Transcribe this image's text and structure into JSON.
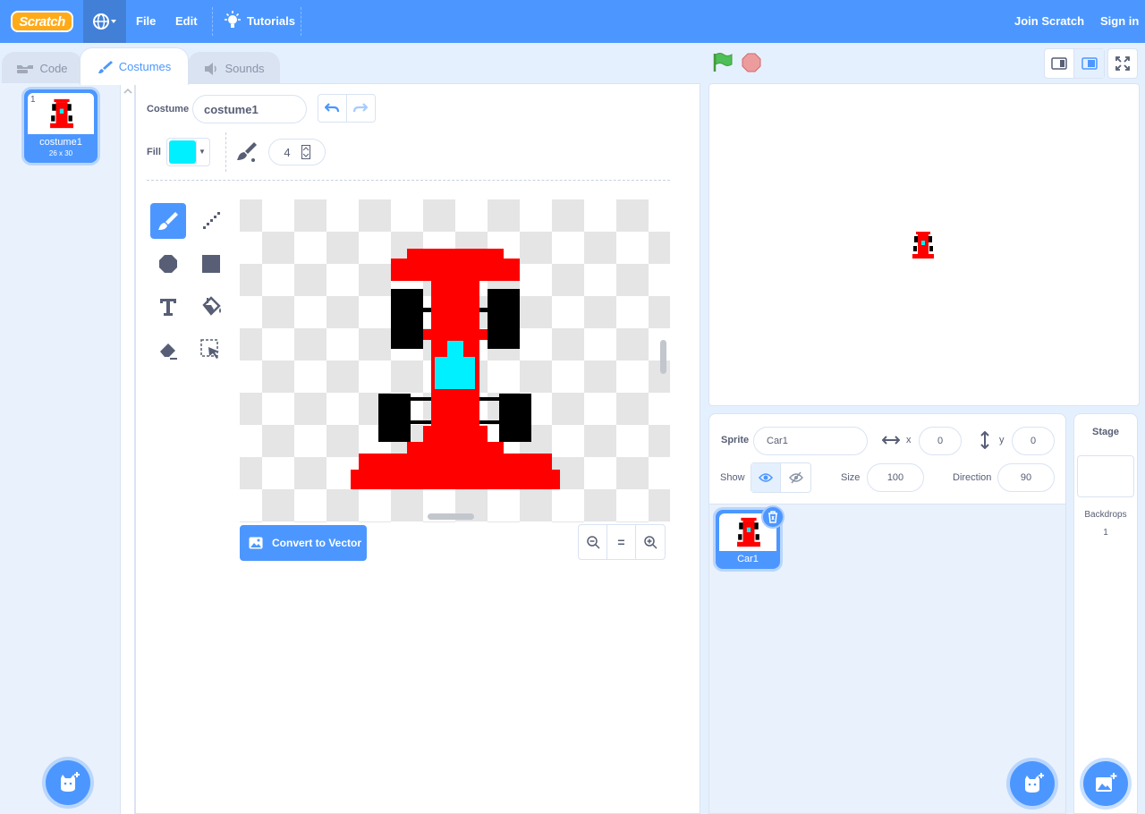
{
  "menubar": {
    "logo": "Scratch",
    "file": "File",
    "edit": "Edit",
    "tutorials": "Tutorials",
    "join": "Join Scratch",
    "signin": "Sign in"
  },
  "tabs": [
    {
      "label": "Code",
      "icon": "code-icon"
    },
    {
      "label": "Costumes",
      "icon": "brush-icon"
    },
    {
      "label": "Sounds",
      "icon": "speaker-icon"
    }
  ],
  "costume_list": {
    "items": [
      {
        "index": "1",
        "name": "costume1",
        "size": "26 x 30"
      }
    ]
  },
  "editor": {
    "costume_label": "Costume",
    "costume_name": "costume1",
    "fill_label": "Fill",
    "fill_color": "#00f0ff",
    "brush_size": "4",
    "convert_label": "Convert to Vector",
    "zoom_reset": "="
  },
  "sprite": {
    "sprite_label": "Sprite",
    "name": "Car1",
    "x_label": "x",
    "x": "0",
    "y_label": "y",
    "y": "0",
    "show_label": "Show",
    "size_label": "Size",
    "size": "100",
    "direction_label": "Direction",
    "direction": "90",
    "tile_name": "Car1"
  },
  "stage_pane": {
    "title": "Stage",
    "backdrops_label": "Backdrops",
    "backdrops_count": "1"
  },
  "colors": {
    "accent": "#4c97ff",
    "car_red": "#ff0000",
    "car_cyan": "#00f0ff",
    "tire": "#000000"
  }
}
